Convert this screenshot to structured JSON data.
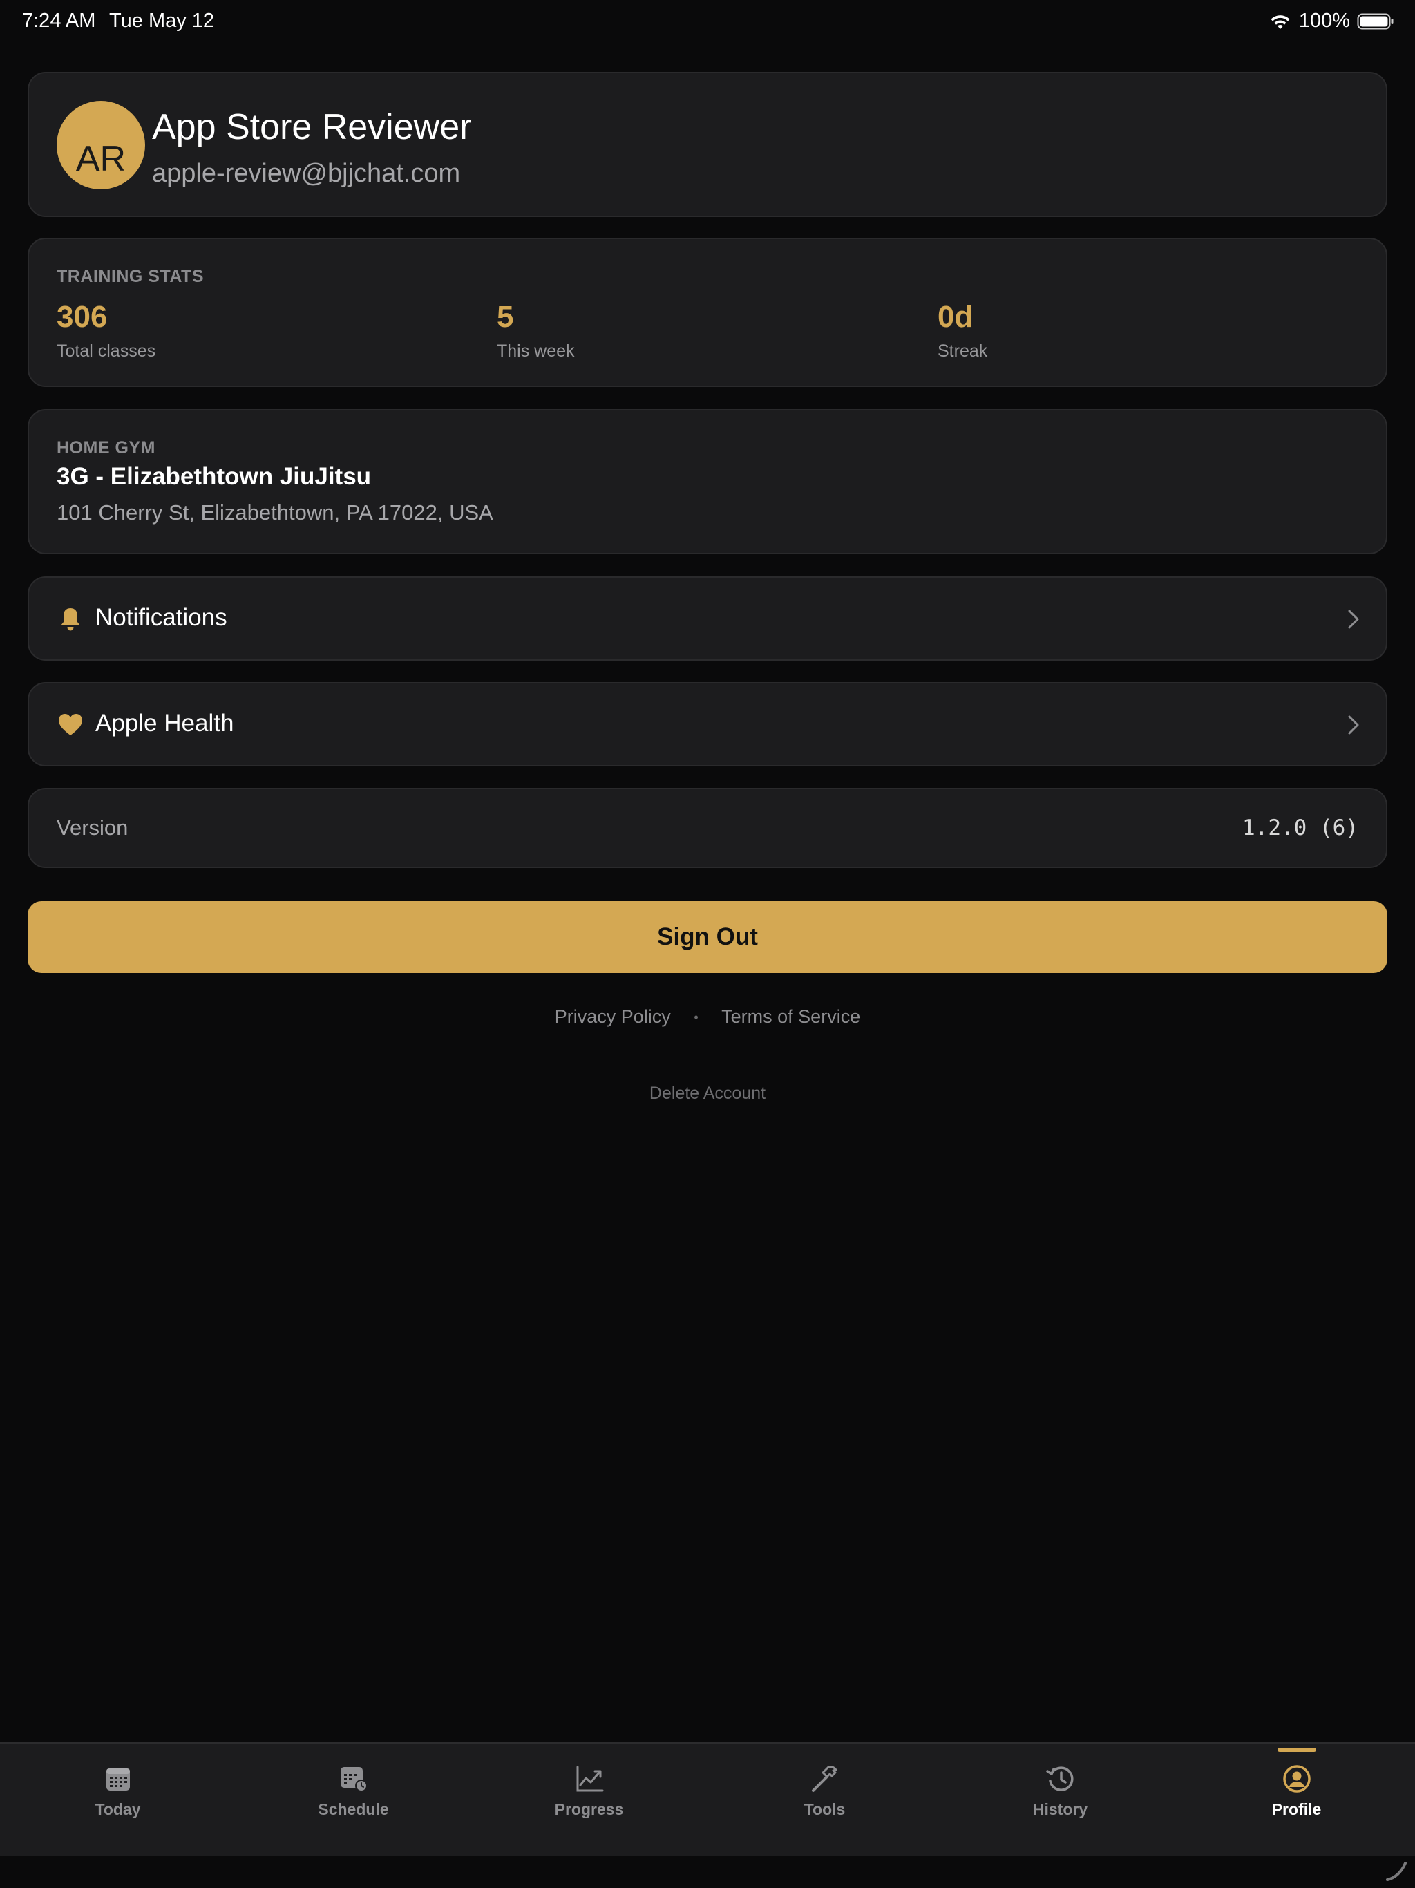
{
  "status_bar": {
    "time": "7:24 AM",
    "date": "Tue May 12",
    "battery_percent": "100%",
    "icons": [
      "wifi-icon",
      "battery-icon"
    ]
  },
  "profile": {
    "initials": "AR",
    "name": "App Store Reviewer",
    "email": "apple-review@bjjchat.com"
  },
  "training_stats": {
    "label": "TRAINING STATS",
    "items": [
      {
        "value": "306",
        "label": "Total classes"
      },
      {
        "value": "5",
        "label": "This week"
      },
      {
        "value": "0d",
        "label": "Streak"
      }
    ]
  },
  "home_gym": {
    "label": "HOME GYM",
    "name": "3G - Elizabethtown JiuJitsu",
    "address": "101 Cherry St, Elizabethtown, PA 17022, USA"
  },
  "settings": {
    "notifications": {
      "label": "Notifications",
      "icon": "bell-icon"
    },
    "apple_health": {
      "label": "Apple Health",
      "icon": "heart-icon"
    }
  },
  "version": {
    "label": "Version",
    "value": "1.2.0 (6)"
  },
  "actions": {
    "sign_out": "Sign Out",
    "privacy_policy": "Privacy Policy",
    "separator": "•",
    "terms": "Terms of Service",
    "delete_account": "Delete Account"
  },
  "tabs": [
    {
      "label": "Today",
      "icon": "calendar-icon",
      "active": false
    },
    {
      "label": "Schedule",
      "icon": "schedule-icon",
      "active": false
    },
    {
      "label": "Progress",
      "icon": "chart-icon",
      "active": false
    },
    {
      "label": "Tools",
      "icon": "hammer-icon",
      "active": false
    },
    {
      "label": "History",
      "icon": "history-icon",
      "active": false
    },
    {
      "label": "Profile",
      "icon": "profile-icon",
      "active": true
    }
  ],
  "colors": {
    "accent": "#d4a853",
    "background": "#0a0a0b",
    "card": "#1c1c1e"
  }
}
